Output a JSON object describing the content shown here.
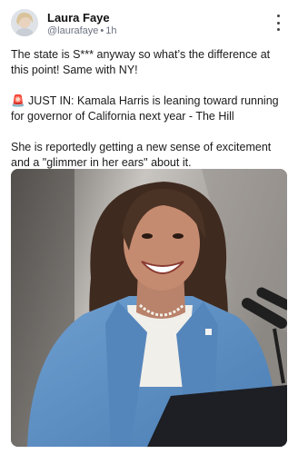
{
  "post": {
    "author": {
      "name": "Laura Faye",
      "handle": "@laurafaye",
      "time": "1h"
    },
    "paragraphs": [
      "The state is S*** anyway so what’s the difference at this point! Same with NY!",
      "🚨 JUST IN: Kamala Harris is leaning toward running for governor of California next year - The Hill",
      "She is reportedly getting a new sense of excitement and a \"glimmer in her ears\" about it."
    ],
    "image": {
      "icon": "photo-of-woman-speaking-at-podium"
    },
    "more_icon": "vertical-ellipsis-icon"
  },
  "colors": {
    "background": "#ffffff",
    "text": "#1a1a1a",
    "secondary": "#6b7280",
    "blazer": "#5b8fc4"
  }
}
